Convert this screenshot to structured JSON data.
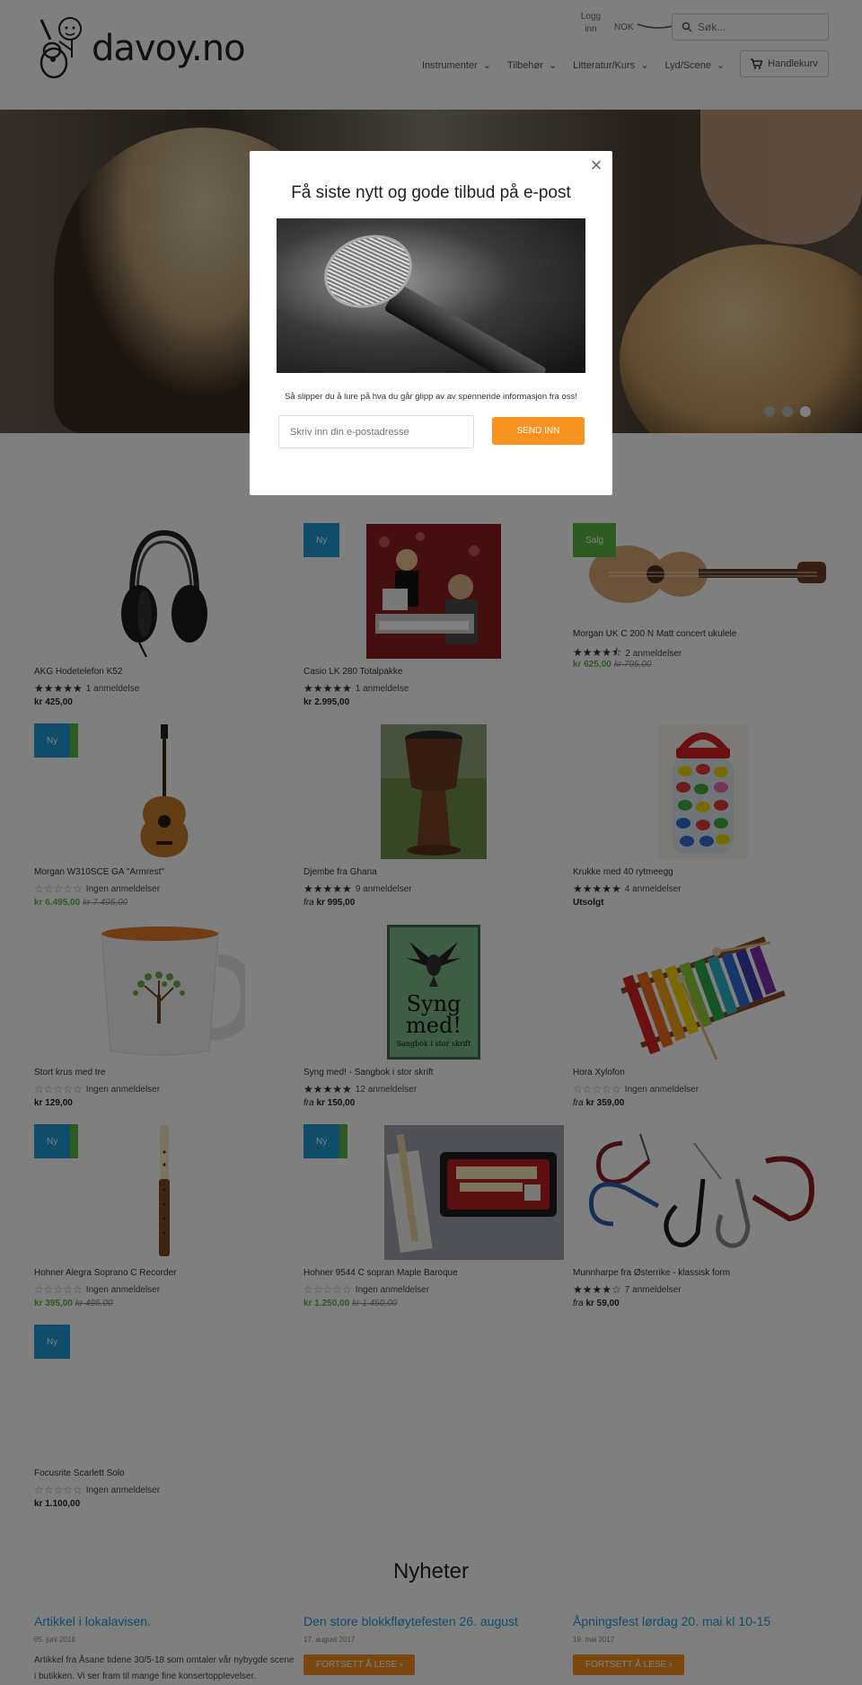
{
  "header": {
    "logo_text": "davoy.no",
    "login": "Logg inn",
    "currency": "NOK",
    "search_placeholder": "Søk...",
    "nav": [
      "Instrumenter",
      "Tilbehør",
      "Litteratur/Kurs",
      "Lyd/Scene"
    ],
    "cart_label": "Handlekurv"
  },
  "hero": {
    "slides": 3,
    "active_slide": 3
  },
  "products": [
    {
      "name": "AKG Hodetelefon K52",
      "rating": 5,
      "reviews": "1 anmeldelse",
      "price": "kr 425,00",
      "badge": ""
    },
    {
      "name": "Casio LK 280 Totalpakke",
      "rating": 5,
      "reviews": "1 anmeldelse",
      "price": "kr 2.995,00",
      "badge": "Ny"
    },
    {
      "name": "Morgan UK C 200 N Matt concert ukulele",
      "rating": 4.5,
      "reviews": "2 anmeldelser",
      "price": "kr 625,00",
      "old_price": "kr 795,00",
      "badge": "Salg"
    },
    {
      "name": "Morgan W310SCE GA \"Armrest\"",
      "rating": 0,
      "reviews": "Ingen anmeldelser",
      "price": "kr 6.495,00",
      "old_price": "kr 7.495,00",
      "badge": "Ny"
    },
    {
      "name": "Djembe fra Ghana",
      "rating": 5,
      "reviews": "9 anmeldelser",
      "price_prefix": "fra",
      "price": "kr 995,00",
      "badge": ""
    },
    {
      "name": "Krukke med 40 rytmeegg",
      "rating": 5,
      "reviews": "4 anmeldelser",
      "price": "Utsolgt",
      "badge": ""
    },
    {
      "name": "Stort krus med tre",
      "rating": 0,
      "reviews": "Ingen anmeldelser",
      "price": "kr 129,00",
      "badge": ""
    },
    {
      "name": "Syng med! - Sangbok i stor skrift",
      "rating": 5,
      "reviews": "12 anmeldelser",
      "price_prefix": "fra",
      "price": "kr 150,00",
      "badge": ""
    },
    {
      "name": "Hora Xylofon",
      "rating": 0,
      "reviews": "Ingen anmeldelser",
      "price_prefix": "fra",
      "price": "kr 359,00",
      "badge": ""
    },
    {
      "name": "Hohner Alegra Soprano C Recorder",
      "rating": 0,
      "reviews": "Ingen anmeldelser",
      "price": "kr 395,00",
      "old_price": "kr 495,00",
      "badge": "Ny"
    },
    {
      "name": "Hohner 9544 C sopran Maple Baroque",
      "rating": 0,
      "reviews": "Ingen anmeldelser",
      "price": "kr 1.250,00",
      "old_price": "kr 1.450,00",
      "badge": "Ny"
    },
    {
      "name": "Munnharpe fra Østerrike - klassisk form",
      "rating": 4,
      "reviews": "7 anmeldelser",
      "price_prefix": "fra",
      "price": "kr 59,00",
      "badge": ""
    },
    {
      "name": "Focusrite Scarlett Solo",
      "rating": 0,
      "reviews": "Ingen anmeldelser",
      "price": "kr 1.100,00",
      "badge": "Ny"
    }
  ],
  "book_cover": {
    "title": "Syng med!",
    "subtitle": "Sangbok i stor skrift"
  },
  "news": {
    "heading": "Nyheter",
    "items": [
      {
        "title": "Artikkel i lokalavisen.",
        "date": "05. juni 2018",
        "text": "Artikkel fra Åsane tidene 30/5-18 som omtaler vår nybygde scene i butikken. Vi ser fram til mange fine konsertopplevelser.",
        "button": "FORTSETT Å LESE"
      },
      {
        "title": "Den store blokkfløytefesten 26. august",
        "date": "17. august 2017",
        "text": "",
        "button": "FORTSETT Å LESE"
      },
      {
        "title": "Åpningsfest lørdag 20. mai kl 10-15",
        "date": "19. mai 2017",
        "text": "",
        "button": "FORTSETT Å LESE"
      }
    ]
  },
  "modal": {
    "title": "Få siste nytt og gode tilbud på e-post",
    "subtitle": "Så slipper du å lure på hva du går glipp av av spennende informasjon fra oss!",
    "email_placeholder": "Skriv inn din e-postadresse",
    "button": "SEND INN",
    "close": "×"
  },
  "colors": {
    "accent": "#1e9ad6",
    "sale": "#5bb543",
    "button": "#f7931e"
  }
}
